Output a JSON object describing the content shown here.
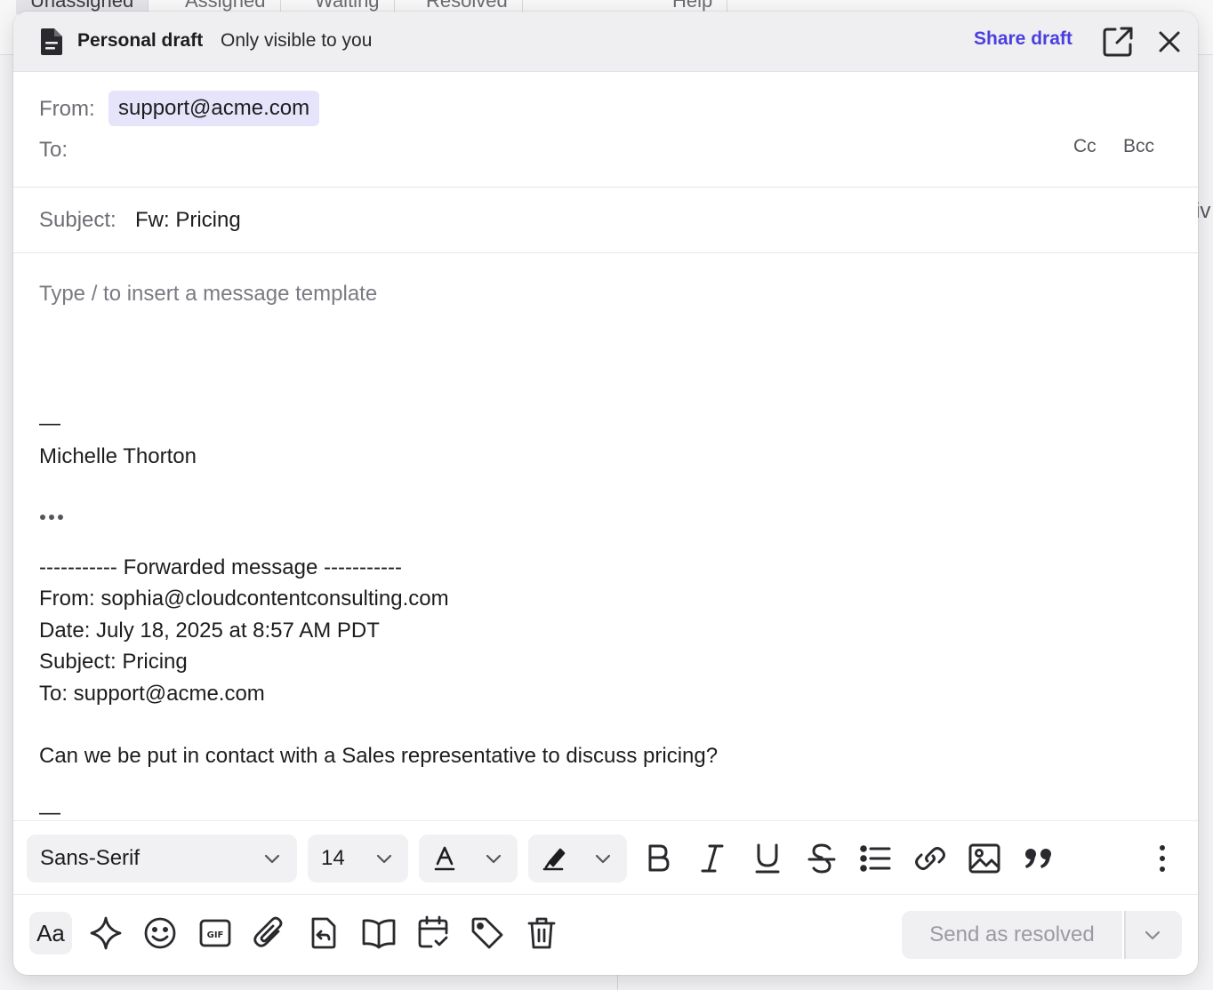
{
  "background": {
    "tabs": [
      "Unassigned",
      "Assigned",
      "Waiting",
      "Resolved"
    ],
    "right_tab": "Help",
    "side_text": "iv"
  },
  "header": {
    "title": "Personal draft",
    "subtitle": "Only visible to you",
    "share_label": "Share draft",
    "icons": [
      "document-icon",
      "popout-icon",
      "close-icon"
    ]
  },
  "fields": {
    "from_label": "From:",
    "from_value": "support@acme.com",
    "to_label": "To:",
    "cc_label": "Cc",
    "bcc_label": "Bcc",
    "subject_label": "Subject:",
    "subject_value": "Fw: Pricing"
  },
  "body": {
    "placeholder": "Type / to insert a message template",
    "signature_dash": "—",
    "signature_name": "Michelle Thorton",
    "forwarded_header": "----------- Forwarded message -----------",
    "forwarded_from": "From: sophia@cloudcontentconsulting.com",
    "forwarded_date": "Date: July 18, 2025 at 8:57 AM PDT",
    "forwarded_subject": "Subject: Pricing",
    "forwarded_to": "To: support@acme.com",
    "message": "Can we be put in contact with a Sales representative to discuss pricing?",
    "trailing_dash": "—"
  },
  "format_toolbar": {
    "font_family": "Sans-Serif",
    "font_size": "14",
    "icons": [
      "text-color-icon",
      "highlight-icon",
      "bold-icon",
      "italic-icon",
      "underline-icon",
      "strikethrough-icon",
      "bullet-list-icon",
      "link-icon",
      "image-icon",
      "quote-icon",
      "more-vertical-icon"
    ]
  },
  "bottom_toolbar": {
    "format_toggle_label": "Aa",
    "icons": [
      "sparkle-icon",
      "emoji-icon",
      "gif-icon",
      "attachment-icon",
      "reply-template-icon",
      "book-icon",
      "calendar-check-icon",
      "tag-icon",
      "trash-icon"
    ],
    "send_label": "Send as resolved"
  },
  "colors": {
    "accent": "#4b3fe0",
    "chip_bg": "#e6e4fa",
    "header_bg": "#efeff1"
  }
}
